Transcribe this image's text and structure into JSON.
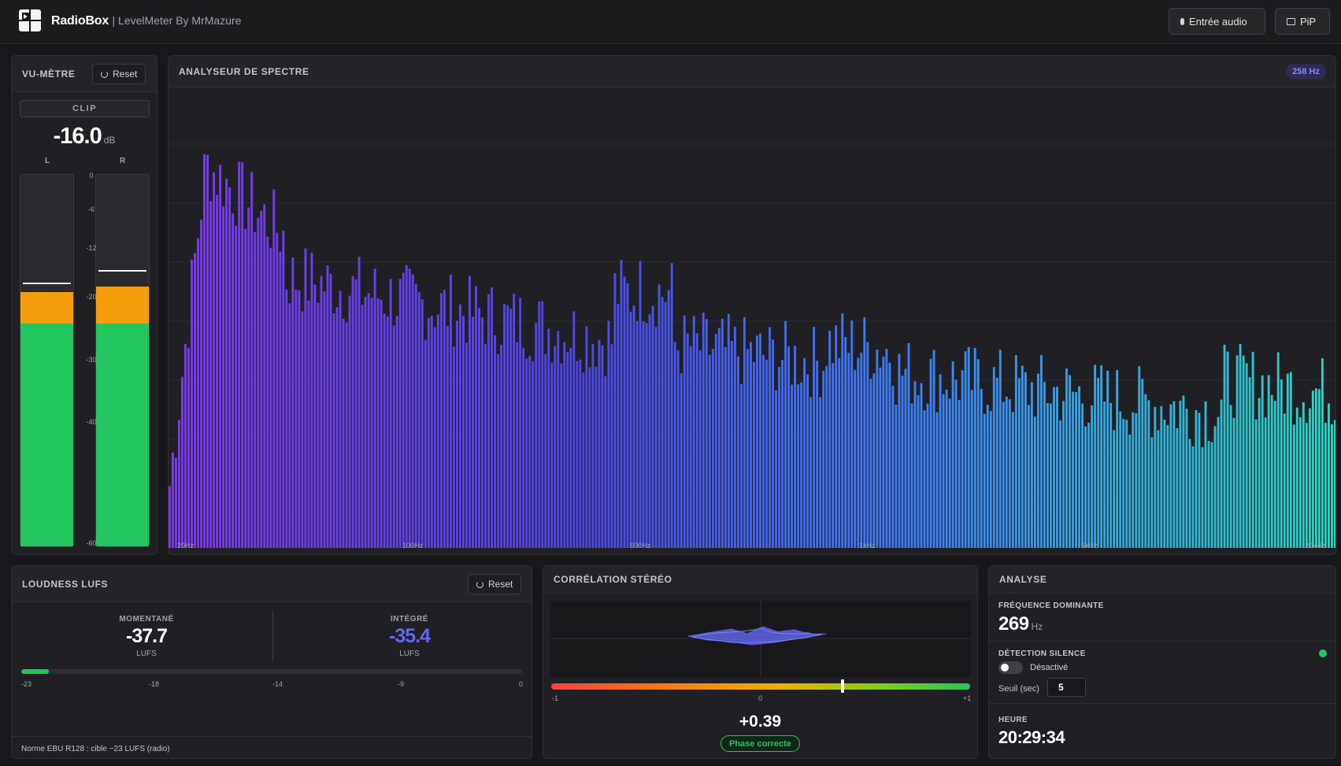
{
  "header": {
    "brand": "RadioBox",
    "subtitle": "| LevelMeter By MrMazure",
    "audio_input_label": "Entrée audio",
    "pip_label": "PiP"
  },
  "vu_meter": {
    "title": "VU-MÈTRE",
    "reset_label": "Reset",
    "clip_label": "CLIP",
    "level_value": "-16.0",
    "level_unit": "dB",
    "left_label": "L",
    "right_label": "R",
    "scale_labels": [
      "0",
      "-6",
      "-12",
      "-20",
      "-30",
      "-40",
      "-60"
    ],
    "left": {
      "green_level": 0.6,
      "orange_level": 0.085,
      "peak_level": 0.705
    },
    "right": {
      "green_level": 0.6,
      "orange_level": 0.1,
      "peak_level": 0.74
    },
    "colors": {
      "green": "#22c55e",
      "orange": "#f59e0b"
    }
  },
  "spectrum": {
    "title": "ANALYSEUR DE SPECTRE",
    "badge": "258 Hz",
    "x_labels": [
      "20Hz",
      "100Hz",
      "500Hz",
      "1kHz",
      "5kHz",
      "20kHz"
    ],
    "gradient": [
      "#7c3aed",
      "#4f46e5",
      "#2dd4bf"
    ]
  },
  "loudness": {
    "title": "LOUDNESS LUFS",
    "reset_label": "Reset",
    "momentary_label": "MOMENTANÉ",
    "momentary_value": "-37.7",
    "momentary_unit": "LUFS",
    "integrated_label": "INTÉGRÉ",
    "integrated_value": "-35.4",
    "integrated_unit": "LUFS",
    "bar_level": 0.055,
    "scale_labels": [
      "-23",
      "-18",
      "-14",
      "-9",
      "0"
    ],
    "footer": "Norme EBU R128 : cible −23 LUFS (radio)",
    "integrated_color": "#6366f1"
  },
  "correlation": {
    "title": "CORRÉLATION STÉRÉO",
    "value": "+0.39",
    "value_num": 0.39,
    "scale_labels": [
      "-1",
      "0",
      "+1"
    ],
    "status": "Phase correcte",
    "status_color": "#22c55e"
  },
  "analysis": {
    "title": "ANALYSE",
    "dominant_label": "FRÉQUENCE DOMINANTE",
    "dominant_value": "269",
    "dominant_unit": "Hz",
    "silence_label": "DÉTECTION SILENCE",
    "silence_state": "Désactivé",
    "threshold_label": "Seuil (sec)",
    "threshold_value": "5",
    "time_label": "HEURE",
    "time_value": "20:29:34"
  }
}
